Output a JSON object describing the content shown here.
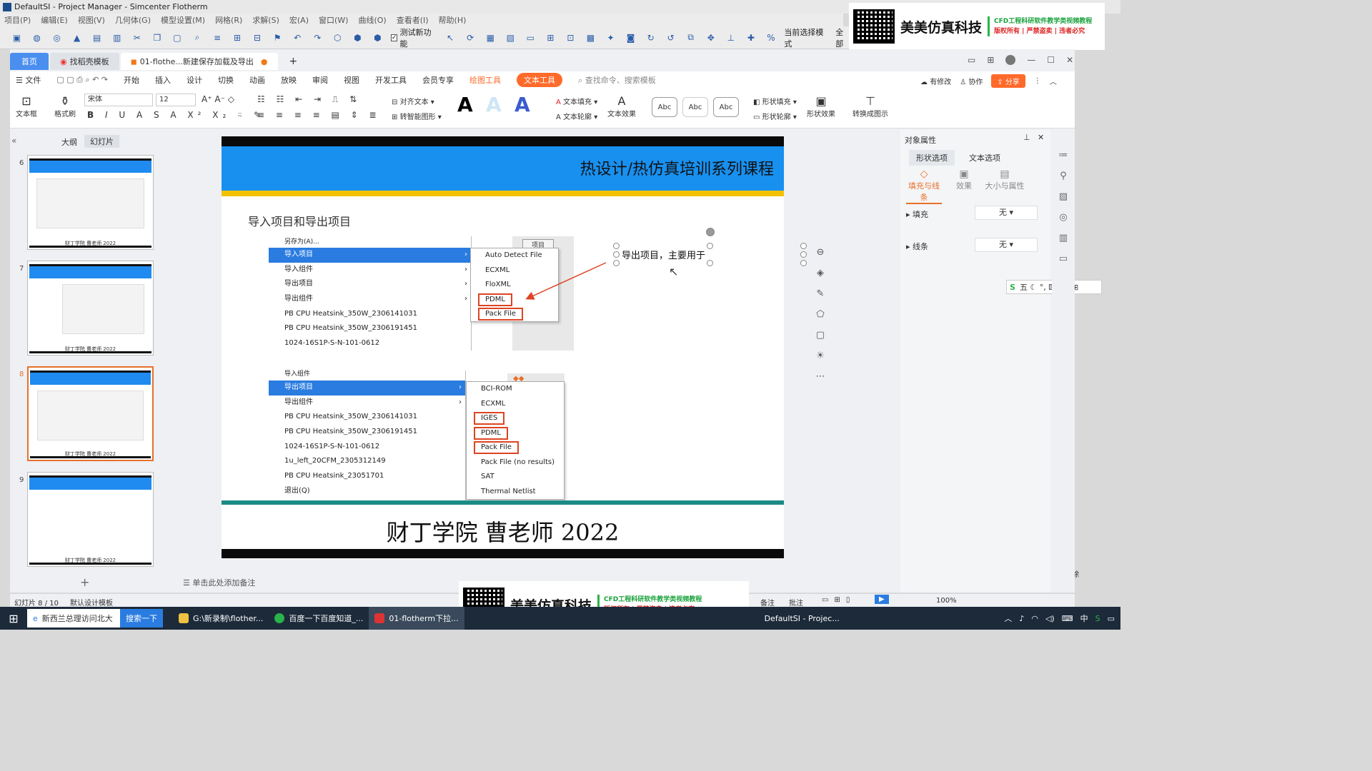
{
  "flotherm": {
    "title": "DefaultSI - Project Manager - Simcenter Flotherm",
    "menu": [
      "项目(P)",
      "编辑(E)",
      "视图(V)",
      "几何体(G)",
      "模型设置(M)",
      "网格(R)",
      "求解(S)",
      "宏(A)",
      "窗口(W)",
      "曲线(O)",
      "查看者(I)",
      "帮助(H)"
    ],
    "test_feature": "测试新功能",
    "select_mode_label": "当前选择模式",
    "select_mode_value": "全部"
  },
  "banner": {
    "brand": "美美仿真科技",
    "line1": "CFD工程科研软件教学类视频教程",
    "line2": "版权所有 | 严禁盗卖 | 违者必究"
  },
  "tabs": {
    "home": "首页",
    "tab2": "找稻壳模板",
    "tab3": "01-flothe...新建保存加载及导出",
    "add": "+"
  },
  "ribbon_menu": [
    "文件",
    "开始",
    "插入",
    "设计",
    "切换",
    "动画",
    "放映",
    "审阅",
    "视图",
    "开发工具",
    "会员专享"
  ],
  "ribbon_tools": {
    "draw": "绘图工具",
    "text": "文本工具",
    "search": "查找命令、搜索模板"
  },
  "ribbon_right": {
    "modified": "有修改",
    "collab": "协作",
    "share": "分享"
  },
  "ribbon": {
    "textbox": "文本框",
    "format_painter": "格式刷",
    "font": "宋体",
    "size": "12",
    "align_text": "对齐文本",
    "smart_shape": "转智能图形",
    "text_fill": "文本填充",
    "text_outline": "文本轮廓",
    "text_effect": "文本效果",
    "shape_fill": "形状填充",
    "shape_outline": "形状轮廓",
    "shape_effect": "形状效果",
    "convert": "转换成图示",
    "abc": "Abc"
  },
  "left_pane": {
    "tab_outline": "大纲",
    "tab_slides": "幻灯片",
    "slides": [
      {
        "num": "6",
        "footer": "财丁学院 曹老师 2022"
      },
      {
        "num": "7",
        "footer": "财丁学院 曹老师 2022"
      },
      {
        "num": "8",
        "footer": "财丁学院 曹老师 2022"
      },
      {
        "num": "9",
        "footer": "财丁学院 曹老师 2022"
      }
    ],
    "add": "+"
  },
  "slide": {
    "header": "热设计/热仿真培训系列课程",
    "subtitle": "导入项目和导出项目",
    "textbox": "导出项目，主要用于",
    "footer": "财丁学院  曹老师  2022",
    "menu1": {
      "top": "另存为(A)...",
      "items": [
        "导入项目",
        "导入组件",
        "导出项目",
        "导出组件",
        "PB CPU Heatsink_350W_2306141031",
        "PB CPU Heatsink_350W_2306191451",
        "1024-16S1P-S-N-101-0612"
      ],
      "tag": "项目",
      "sub": [
        "Auto Detect File",
        "ECXML",
        "FloXML",
        "PDML",
        "Pack File"
      ]
    },
    "menu2": {
      "top": "导入组件",
      "items": [
        "导出项目",
        "导出组件",
        "PB CPU Heatsink_350W_2306141031",
        "PB CPU Heatsink_350W_2306191451",
        "1024-16S1P-S-N-101-0612",
        "1u_left_20CFM_2305312149",
        "PB CPU Heatsink_23051701",
        "退出(Q)"
      ],
      "sub": [
        "BCI-ROM",
        "ECXML",
        "IGES",
        "PDML",
        "Pack File",
        "Pack File (no results)",
        "SAT",
        "Thermal Netlist"
      ]
    }
  },
  "right_pane": {
    "title": "对象属性",
    "tab_shape": "形状选项",
    "tab_text": "文本选项",
    "sub1": "填充与线条",
    "sub2": "效果",
    "sub3": "大小与属性",
    "fill_label": "填充",
    "fill_value": "无",
    "line_label": "线条",
    "line_value": "无",
    "clear": "清除"
  },
  "note": "单击此处添加备注",
  "status": {
    "slide_count": "幻灯片 8 / 10",
    "template": "默认设计模板",
    "notes": "备注",
    "comments": "批注",
    "zoom": "100%"
  },
  "taskbar": {
    "search": "新西兰总理访问北大",
    "search_btn": "搜索一下",
    "items": [
      "G:\\新录制\\flother...",
      "百度一下百度知道_...",
      "01-flotherm下拉...",
      "DefaultSI - Projec..."
    ],
    "ime": "中"
  }
}
